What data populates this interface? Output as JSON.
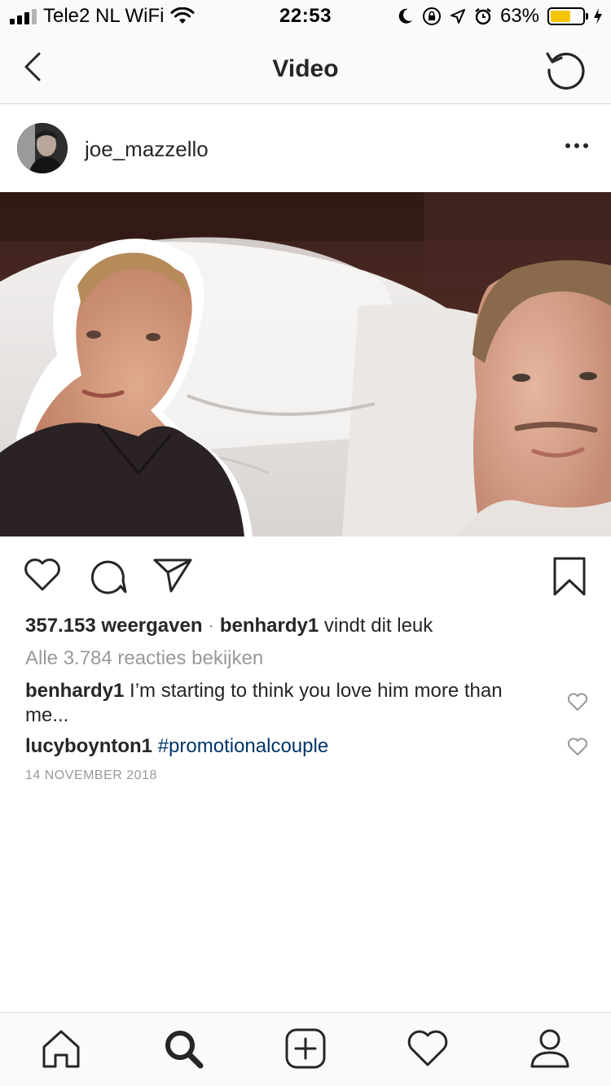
{
  "status_bar": {
    "carrier": "Tele2 NL WiFi",
    "time": "22:53",
    "battery_percent": "63%",
    "battery_level": 0.63
  },
  "nav": {
    "title": "Video",
    "back_icon": "chevron-left-icon",
    "refresh_icon": "refresh-icon"
  },
  "post": {
    "username": "joe_mazzello",
    "views_count": "357.153 weergaven",
    "separator": " · ",
    "liked_by": "benhardy1",
    "liked_suffix": " vindt dit leuk",
    "view_all_comments": "Alle 3.784 reacties bekijken",
    "comments": [
      {
        "user": "benhardy1",
        "text": " I’m starting to think you love him more than me..."
      },
      {
        "user": "lucyboynton1",
        "text": " ",
        "hashtag": "#promotionalcouple"
      }
    ],
    "date": "14 NOVEMBER 2018"
  },
  "tabs": [
    "home-icon",
    "search-icon",
    "new-post-icon",
    "activity-icon",
    "profile-icon"
  ],
  "colors": {
    "text": "#262626",
    "secondary": "#999999",
    "hashtag": "#003569",
    "battery": "#f5c400",
    "divider": "#dbdbdb"
  }
}
